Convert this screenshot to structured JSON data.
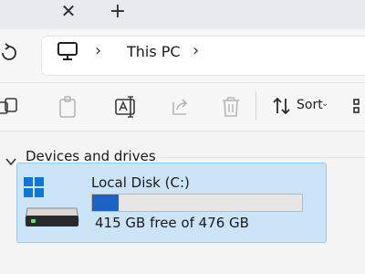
{
  "tabstrip": {
    "close_icon": "close-icon",
    "close_glyph": "✕",
    "new_tab_icon": "plus-icon",
    "new_tab_glyph": "+"
  },
  "address_bar": {
    "refresh_icon": "refresh-icon",
    "location_icon": "computer-icon",
    "separator_glyph": "›",
    "breadcrumb": [
      "This PC"
    ]
  },
  "command_bar": {
    "commands": [
      {
        "name": "copy",
        "icon": "copy-icon"
      },
      {
        "name": "paste",
        "icon": "paste-icon"
      },
      {
        "name": "rename",
        "icon": "rename-icon"
      },
      {
        "name": "share",
        "icon": "share-icon"
      },
      {
        "name": "delete",
        "icon": "delete-icon"
      }
    ],
    "sort": {
      "label": "Sort",
      "icon": "sort-icon",
      "caret_glyph": "⌄"
    },
    "view_icon": "view-icon"
  },
  "content": {
    "group": {
      "label": "Devices and drives",
      "icon": "chevron-down-icon"
    },
    "drives": [
      {
        "name": "Local Disk (C:)",
        "icon": "windows-drive-icon",
        "free_text": "415 GB free of 476 GB",
        "used_fraction": 0.128
      }
    ]
  },
  "colors": {
    "selection_fill": "#cce4f7",
    "selection_border": "#99c9ef",
    "usage_bar": "#1a64c8",
    "windows_logo": "#0f78d4"
  }
}
